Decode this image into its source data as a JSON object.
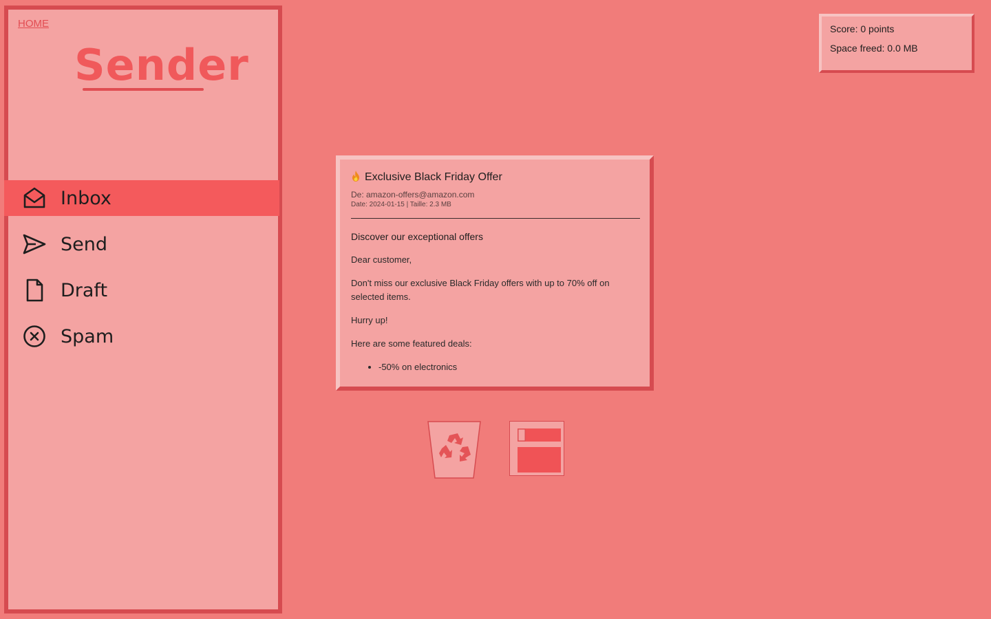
{
  "nav": {
    "home_label": "HOME",
    "logo": "Sender",
    "items": [
      {
        "label": "Inbox",
        "icon": "envelope-open-icon",
        "active": true
      },
      {
        "label": "Send",
        "icon": "paper-plane-icon",
        "active": false
      },
      {
        "label": "Draft",
        "icon": "document-icon",
        "active": false
      },
      {
        "label": "Spam",
        "icon": "circle-x-icon",
        "active": false
      }
    ]
  },
  "stats": {
    "score_label": "Score:",
    "score_value": "0 points",
    "space_label": "Space freed:",
    "space_value": "0.0 MB"
  },
  "email": {
    "subject": "Exclusive Black Friday Offer",
    "from_line": "De: amazon-offers@amazon.com",
    "meta_line": "Date: 2024-01-15 | Taille: 2.3 MB",
    "heading": "Discover our exceptional offers",
    "greeting": "Dear customer,",
    "paragraph": "Don't miss our exclusive Black Friday offers with up to 70% off on selected items.",
    "urgency": "Hurry up!",
    "deals_intro": "Here are some featured deals:",
    "deals": [
      "-50% on electronics"
    ]
  },
  "actions": {
    "delete_icon": "recycle-bin-icon",
    "archive_icon": "archive-icon"
  },
  "colors": {
    "background": "#f17c7a",
    "panel": "#f4a3a2",
    "border": "#d64b50",
    "accent": "#f45a5c"
  }
}
